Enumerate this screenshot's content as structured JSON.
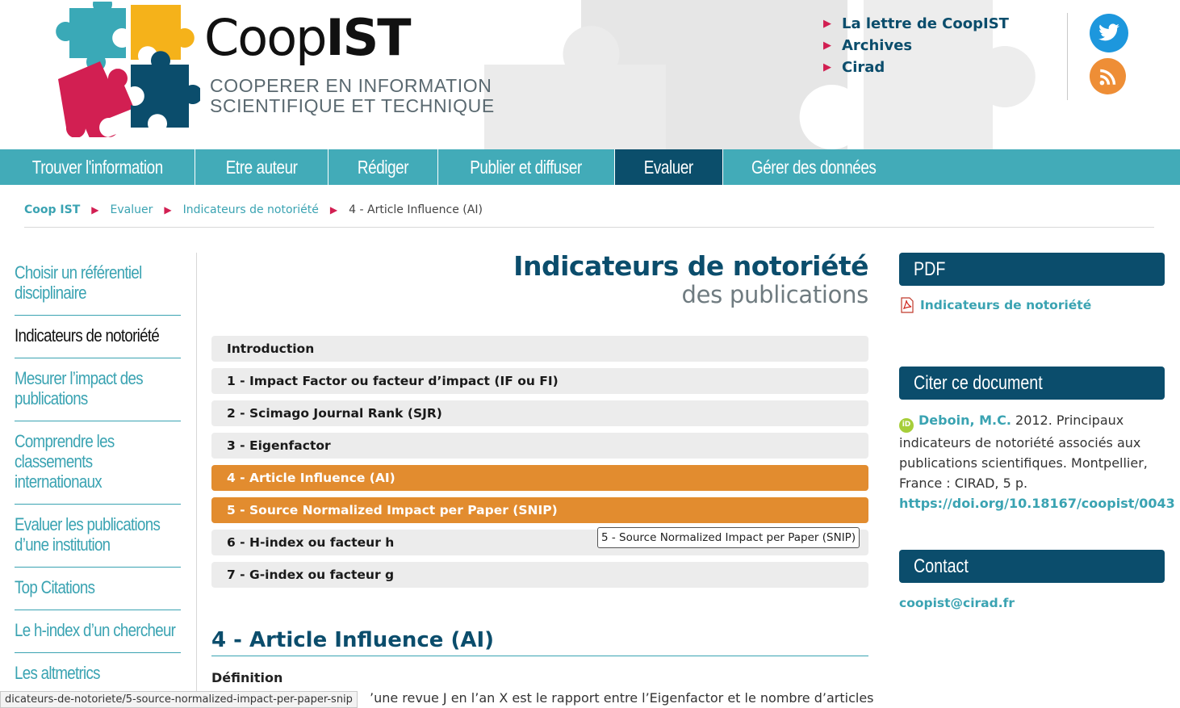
{
  "header": {
    "logo_coop": "Coop",
    "logo_ist": "IST",
    "tagline_line1": "COOPERER EN INFORMATION",
    "tagline_line2": "SCIENTIFIQUE ET TECHNIQUE",
    "top_links": [
      "La lettre de CoopIST",
      "Archives",
      "Cirad"
    ],
    "social": {
      "twitter_color": "#1d97dd",
      "rss_color": "#ee8e36"
    }
  },
  "nav": {
    "items": [
      {
        "label": "Trouver l'information"
      },
      {
        "label": "Etre auteur"
      },
      {
        "label": "Rédiger"
      },
      {
        "label": "Publier et diffuser"
      },
      {
        "label": "Evaluer"
      },
      {
        "label": "Gérer des données"
      }
    ],
    "active_index": 4,
    "bar_color": "#42abb8",
    "active_color": "#0b4e6b"
  },
  "breadcrumb": {
    "home": "Coop IST",
    "items": [
      "Evaluer",
      "Indicateurs de notoriété"
    ],
    "current": "4 - Article Influence (AI)"
  },
  "sidebar": {
    "items": [
      {
        "line1": "Choisir un référentiel",
        "line2": "disciplinaire",
        "line3": ""
      },
      {
        "line1": "Indicateurs de notoriété",
        "line2": "",
        "line3": ""
      },
      {
        "line1": "Mesurer l’impact des",
        "line2": "publications",
        "line3": ""
      },
      {
        "line1": "Comprendre les",
        "line2": "classements",
        "line3": "internationaux"
      },
      {
        "line1": "Evaluer les publications",
        "line2": "d’une institution",
        "line3": ""
      },
      {
        "line1": "Top Citations",
        "line2": "",
        "line3": ""
      },
      {
        "line1": "Le h-index d’un chercheur",
        "line2": "",
        "line3": ""
      },
      {
        "line1": "Les altmetrics",
        "line2": "",
        "line3": ""
      }
    ],
    "active_index": 1
  },
  "main": {
    "title": "Indicateurs de notoriété",
    "subtitle": "des publications",
    "toc": [
      "Introduction",
      "1 - Impact Factor ou facteur d’impact (IF ou FI)",
      "2 - Scimago Journal Rank (SJR)",
      "3 - Eigenfactor",
      "4 - Article Influence (AI)",
      "5 - Source Normalized Impact per Paper (SNIP)",
      "6 - H-index ou facteur h",
      "7 - G-index ou facteur g"
    ],
    "highlight_color": "#e28c2f",
    "tooltip": "5 - Source Normalized Impact per Paper (SNIP)",
    "section_title": "4 - Article Influence (AI)",
    "definition_title": "Définition",
    "definition_text": "’une revue J en l’an X est le rapport entre l’Eigenfactor et le nombre d’articles",
    "status_url": "dicateurs-de-notoriete/5-source-normalized-impact-per-paper-snip"
  },
  "right": {
    "pdf_title": "PDF",
    "pdf_link": "Indicateurs de notoriété",
    "cite_title": "Citer ce document",
    "cite_author": "Deboin, M.C.",
    "cite_body": " 2012. Principaux indicateurs de notoriété associés aux publications scientifiques. Montpellier, France : CIRAD, 5 p.",
    "cite_doi": "https://doi.org/10.18167/coopist/0043",
    "contact_title": "Contact",
    "contact_email": "coopist@cirad.fr",
    "box_color": "#0b4d6c"
  }
}
